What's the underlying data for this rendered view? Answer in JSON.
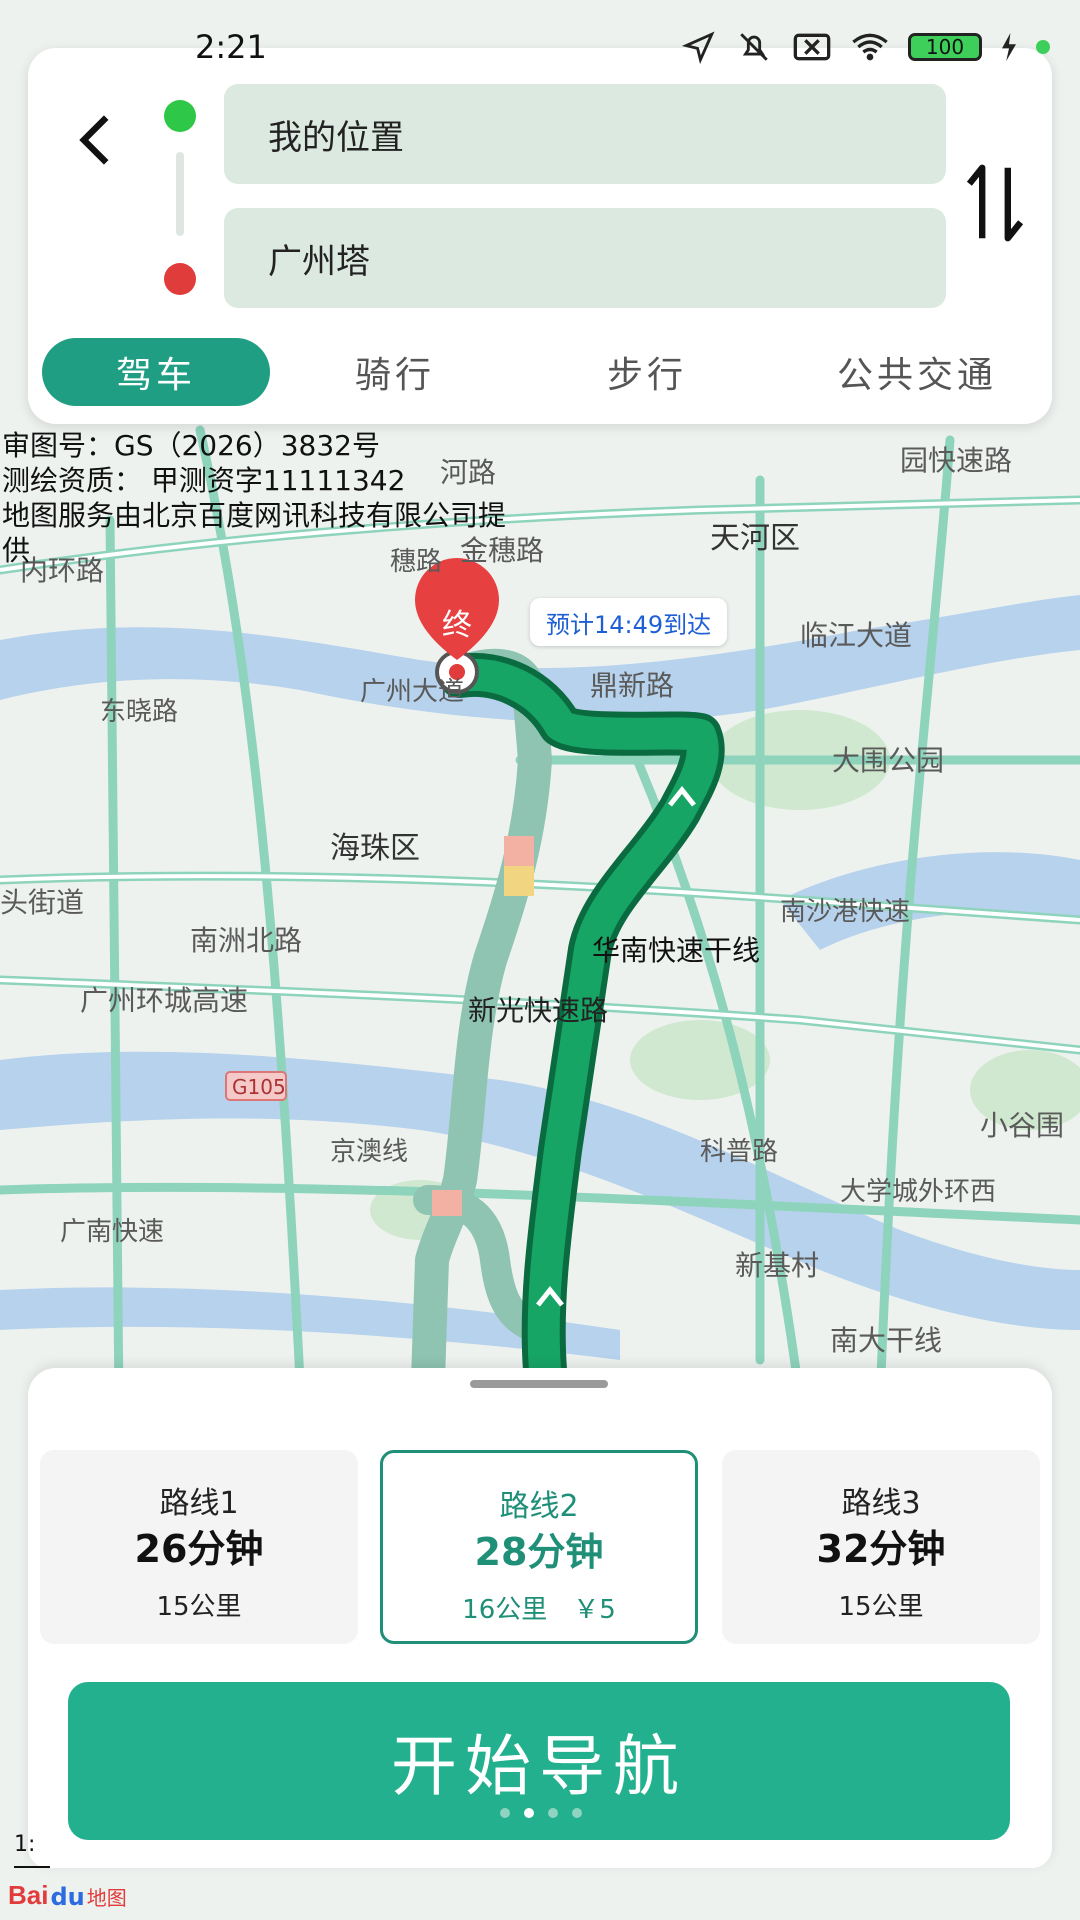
{
  "status": {
    "time": "2:21",
    "battery": "100"
  },
  "search": {
    "from": "我的位置",
    "to": "广州塔"
  },
  "modes": [
    {
      "label": "驾车",
      "active": true
    },
    {
      "label": "骑行",
      "active": false
    },
    {
      "label": "步行",
      "active": false
    },
    {
      "label": "公共交通",
      "active": false
    }
  ],
  "approval": {
    "line1": "审图号：GS（2026）3832号",
    "line2": "测绘资质： 甲测资字11111342",
    "line3": "地图服务由北京百度网讯科技有限公司提供"
  },
  "map": {
    "end_marker": "终",
    "eta": "预计14:49到达",
    "labels": {
      "tianhe": "天河区",
      "haizhu": "海珠区",
      "linjiang": "临江大道",
      "dingxin": "鼎新路",
      "daweipark": "大围公园",
      "jinsui": "金穗路",
      "huangpu_road": "河路",
      "huanlu": "内环路",
      "dongxiao": "东晓路",
      "guangzhou_da": "广州大道",
      "tou_street": "头街道",
      "nanzhou": "南洲北路",
      "huancheng": "广州环城高速",
      "g105": "G105",
      "jingao": "京澳线",
      "guangnan": "广南快速",
      "xinguang": "新光快速路",
      "huanan": "华南快速干线",
      "nansha": "南沙港快速",
      "kepu": "科普路",
      "xinji": "新基村",
      "xiaogu": "小谷围",
      "daxuecheng": "大学城外环西",
      "nanda": "南大干线",
      "pingyuan": "园快速路",
      "suilu": "穗路"
    }
  },
  "routes": [
    {
      "name": "路线1",
      "duration": "26分钟",
      "detail": "15公里",
      "selected": false
    },
    {
      "name": "路线2",
      "duration": "28分钟",
      "detail": "16公里　￥5",
      "selected": true
    },
    {
      "name": "路线3",
      "duration": "32分钟",
      "detail": "15公里",
      "selected": false
    }
  ],
  "navigate_label": "开始导航",
  "scale": "1:",
  "logo": {
    "brand": "Bai",
    "paw": "du",
    "suffix": "地图"
  },
  "colors": {
    "accent": "#22b08e",
    "route": "#17a566",
    "route_alt": "#8fc4b3",
    "start": "#2fc748",
    "end": "#e03c3c"
  }
}
